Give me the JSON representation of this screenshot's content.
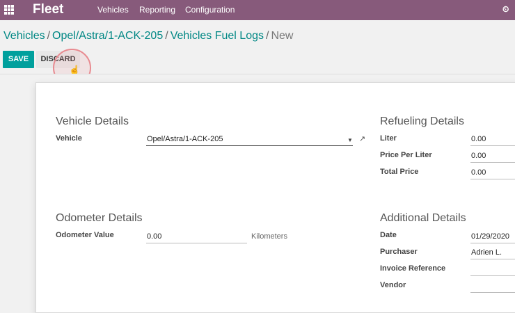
{
  "navbar": {
    "apps_icon": "apps-grid-icon",
    "brand": "Fleet",
    "menu": [
      "Vehicles",
      "Reporting",
      "Configuration"
    ],
    "right_icon": "clock-icon"
  },
  "breadcrumb": {
    "items": [
      "Vehicles",
      "Opel/Astra/1-ACK-205",
      "Vehicles Fuel Logs"
    ],
    "current": "New",
    "separator": "/"
  },
  "buttons": {
    "save": "SAVE",
    "discard": "DISCARD"
  },
  "vehicle_details": {
    "title": "Vehicle Details",
    "vehicle_label": "Vehicle",
    "vehicle_value": "Opel/Astra/1-ACK-205"
  },
  "refueling_details": {
    "title": "Refueling Details",
    "liter_label": "Liter",
    "liter_value": "0.00",
    "price_per_liter_label": "Price Per Liter",
    "price_per_liter_value": "0.00",
    "total_price_label": "Total Price",
    "total_price_value": "0.00"
  },
  "odometer_details": {
    "title": "Odometer Details",
    "odometer_label": "Odometer Value",
    "odometer_value": "0.00",
    "unit": "Kilometers"
  },
  "additional_details": {
    "title": "Additional Details",
    "date_label": "Date",
    "date_value": "01/29/2020",
    "purchaser_label": "Purchaser",
    "purchaser_value": "Adrien L.",
    "invoice_label": "Invoice Reference",
    "invoice_value": "",
    "vendor_label": "Vendor",
    "vendor_value": ""
  },
  "colors": {
    "navbar": "#875a7b",
    "primary": "#00a09d",
    "link": "#008784"
  }
}
